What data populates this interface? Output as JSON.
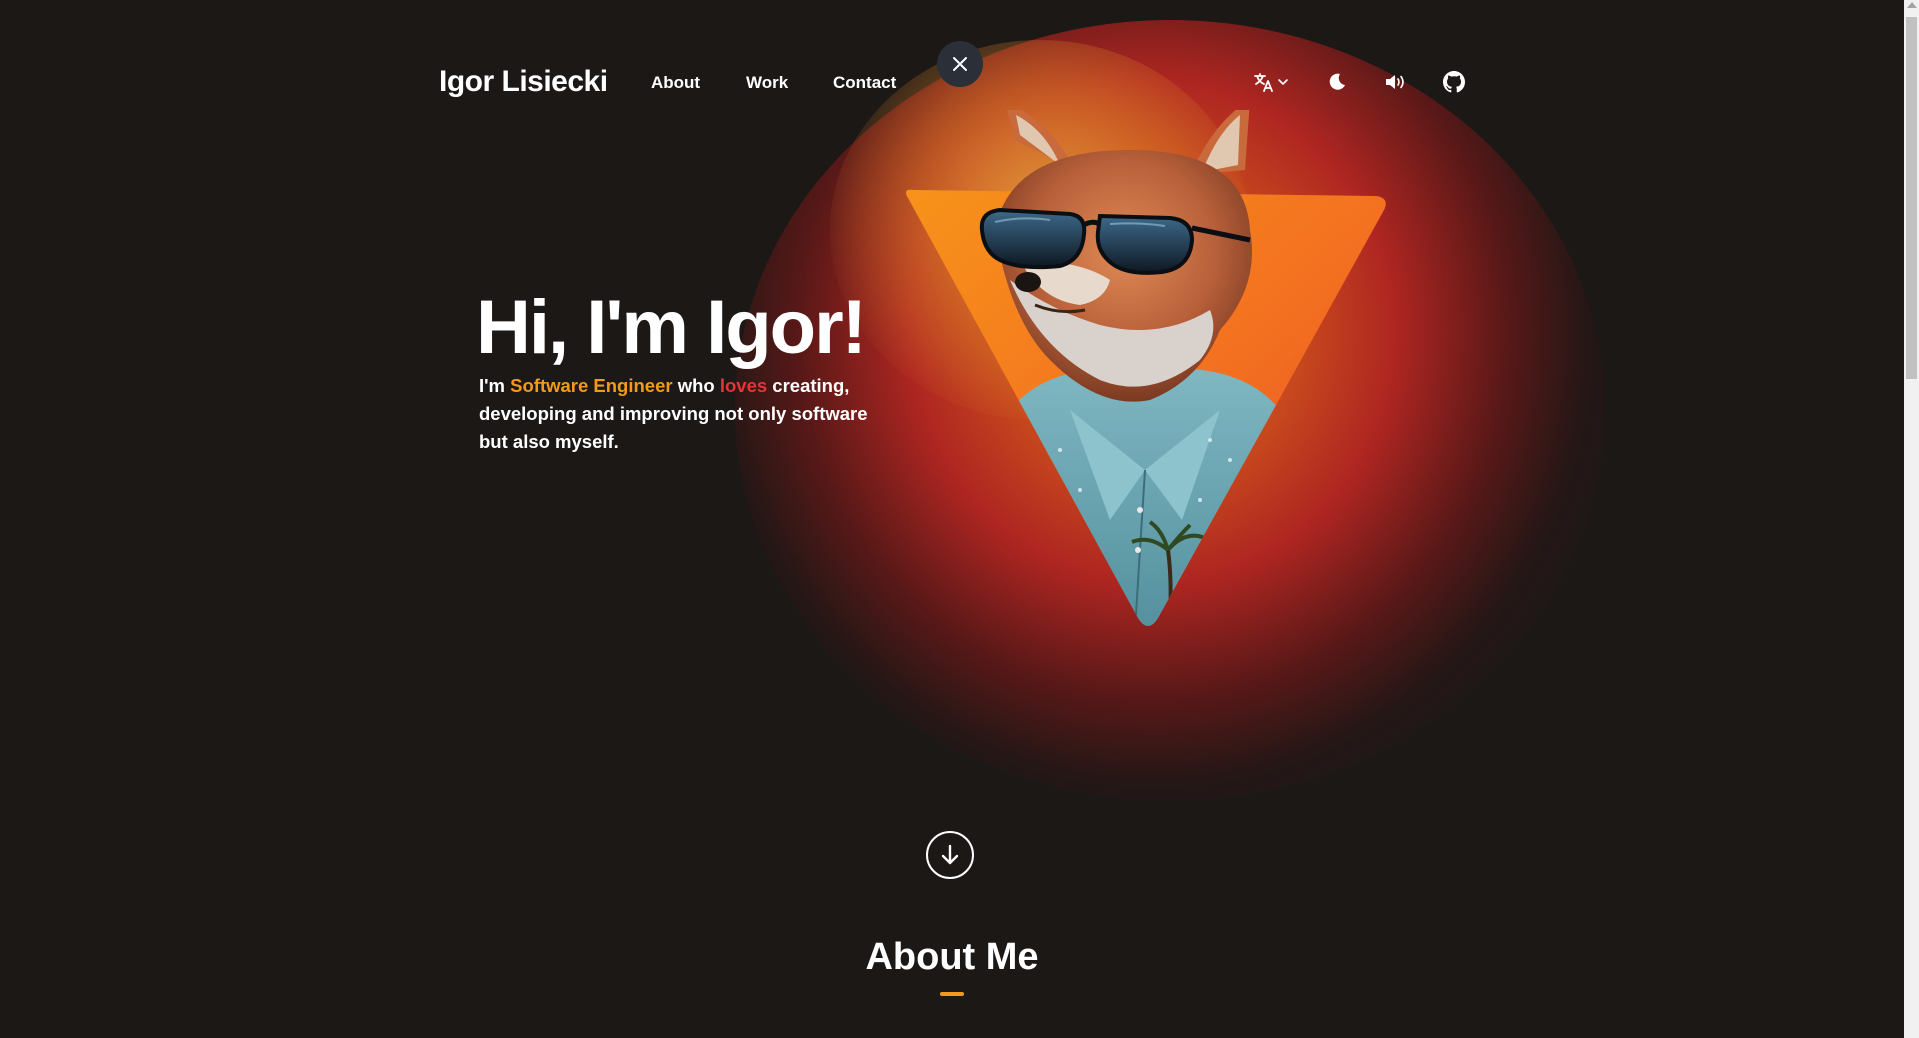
{
  "header": {
    "logo": "Igor Lisiecki",
    "nav": [
      {
        "label": "About"
      },
      {
        "label": "Work"
      },
      {
        "label": "Contact"
      }
    ],
    "icons": [
      "close-icon",
      "translate-icon",
      "chevron-down-icon",
      "moon-icon",
      "volume-icon",
      "github-icon"
    ]
  },
  "hero": {
    "title": "Hi, I'm Igor!",
    "desc_prefix": "I'm ",
    "desc_role": "Software Engineer",
    "desc_who": " who ",
    "desc_loves": "loves",
    "desc_rest": " creating, developing and improving not only software but also myself.",
    "image": "fox-with-sunglasses-illustration"
  },
  "scroll_button": {
    "icon": "arrow-down-circle-icon"
  },
  "about": {
    "title": "About Me"
  },
  "colors": {
    "background": "#1c1816",
    "accent_orange": "#f39a1e",
    "accent_red": "#e53535",
    "text": "#ffffff"
  }
}
